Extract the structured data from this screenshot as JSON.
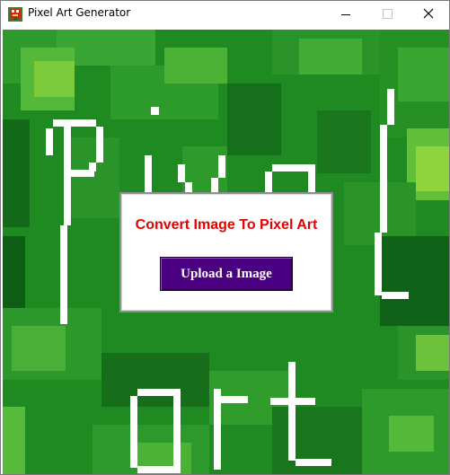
{
  "window": {
    "title": "Pixel Art Generator",
    "icon": "pixel-art-app-icon",
    "controls": {
      "minimize": "minimize-icon",
      "maximize": "maximize-icon",
      "close": "close-icon"
    }
  },
  "background": {
    "image": "pixel-art-background",
    "colors": {
      "dark_green": "#1b7e1e",
      "mid_green": "#2f9a2c",
      "light_green": "#6cc23a",
      "lime": "#8fd43d",
      "deep_green": "#0e5e16",
      "text_white": "#ffffff"
    }
  },
  "dialog": {
    "title": "Convert Image To Pixel Art",
    "title_color": "#e60000",
    "upload_label": "Upload a Image",
    "upload_color": "#4b0082"
  }
}
